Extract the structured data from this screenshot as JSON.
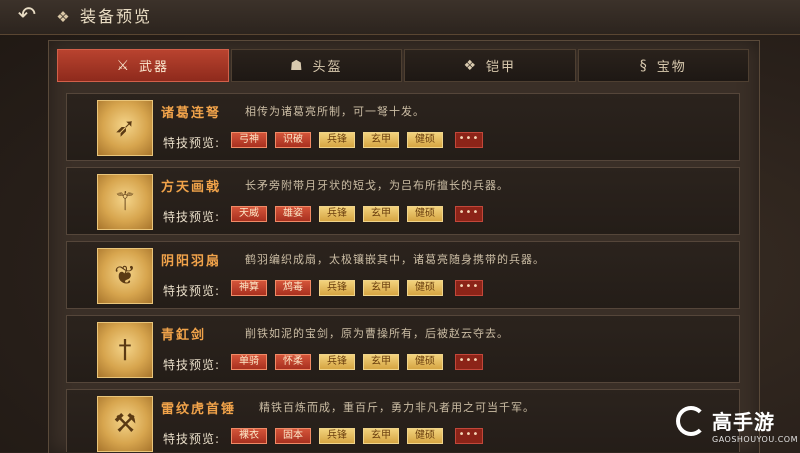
{
  "header": {
    "back_icon": "back-arrow-icon",
    "title_icon": "armor-emblem-icon",
    "title": "装备预览"
  },
  "tabs": [
    {
      "label": "武器",
      "icon": "weapon-icon",
      "active": true
    },
    {
      "label": "头盔",
      "icon": "helmet-icon",
      "active": false
    },
    {
      "label": "铠甲",
      "icon": "armor-icon",
      "active": false
    },
    {
      "label": "宝物",
      "icon": "treasure-icon",
      "active": false
    }
  ],
  "skills_label": "特技预览:",
  "more_label": "•••",
  "items": [
    {
      "name": "诸葛连弩",
      "description": "相传为诸葛亮所制，可一弩十发。",
      "chips": [
        {
          "label": "弓神",
          "style": "red"
        },
        {
          "label": "识破",
          "style": "red"
        },
        {
          "label": "兵锋",
          "style": "gold"
        },
        {
          "label": "玄甲",
          "style": "gold"
        },
        {
          "label": "健硕",
          "style": "gold"
        }
      ]
    },
    {
      "name": "方天画戟",
      "description": "长矛旁附带月牙状的短戈，为吕布所擅长的兵器。",
      "chips": [
        {
          "label": "天威",
          "style": "red"
        },
        {
          "label": "雄姿",
          "style": "red"
        },
        {
          "label": "兵锋",
          "style": "gold"
        },
        {
          "label": "玄甲",
          "style": "gold"
        },
        {
          "label": "健硕",
          "style": "gold"
        }
      ]
    },
    {
      "name": "阴阳羽扇",
      "description": "鹤羽编织成扇，太极镶嵌其中，诸葛亮随身携带的兵器。",
      "chips": [
        {
          "label": "神算",
          "style": "red"
        },
        {
          "label": "鸩毒",
          "style": "red"
        },
        {
          "label": "兵锋",
          "style": "gold"
        },
        {
          "label": "玄甲",
          "style": "gold"
        },
        {
          "label": "健硕",
          "style": "gold"
        }
      ]
    },
    {
      "name": "青釭剑",
      "description": "削铁如泥的宝剑，原为曹操所有，后被赵云夺去。",
      "chips": [
        {
          "label": "单骑",
          "style": "red"
        },
        {
          "label": "怀柔",
          "style": "red"
        },
        {
          "label": "兵锋",
          "style": "gold"
        },
        {
          "label": "玄甲",
          "style": "gold"
        },
        {
          "label": "健硕",
          "style": "gold"
        }
      ]
    },
    {
      "name": "雷纹虎首锤",
      "description": "精铁百炼而成，重百斤，勇力非凡者用之可当千军。",
      "chips": [
        {
          "label": "裸衣",
          "style": "red"
        },
        {
          "label": "固本",
          "style": "red"
        },
        {
          "label": "兵锋",
          "style": "gold"
        },
        {
          "label": "玄甲",
          "style": "gold"
        },
        {
          "label": "健硕",
          "style": "gold"
        }
      ]
    }
  ],
  "watermark": {
    "text": "高手游",
    "sub": "GAOSHOUYOU.COM"
  }
}
